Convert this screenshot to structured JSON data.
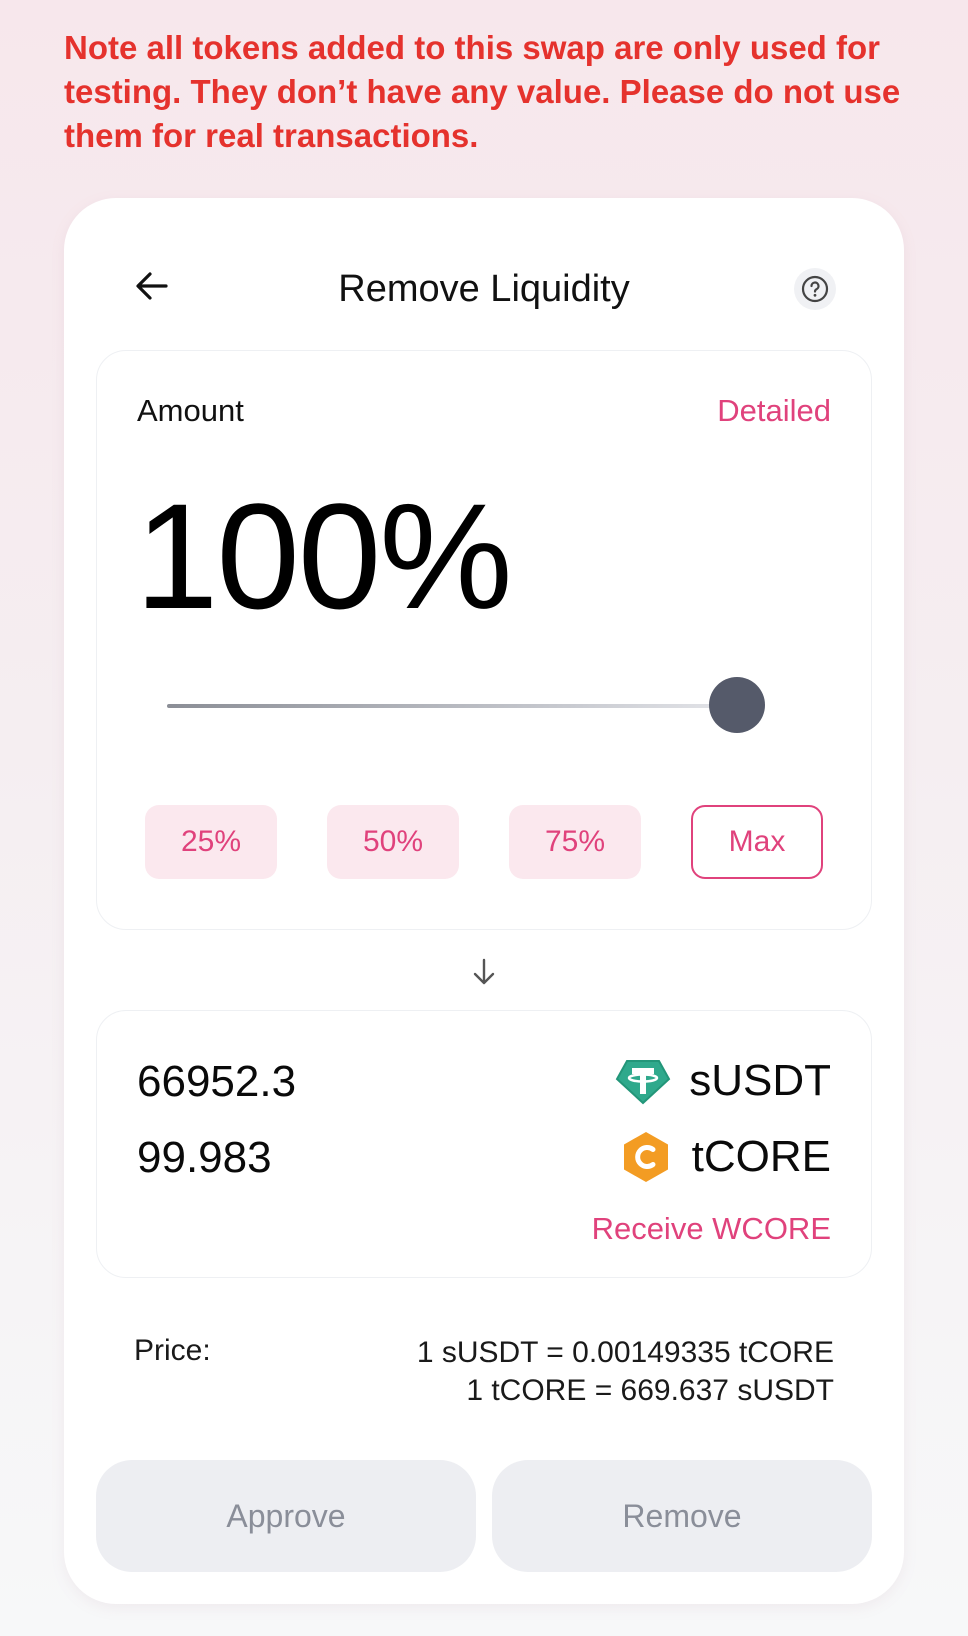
{
  "notice": "Note all tokens added to this swap are only used for testing. They don’t have any value. Please do not use them for real transactions.",
  "header": {
    "title": "Remove Liquidity",
    "back_icon": "arrow-left-icon",
    "help_icon": "question-circle-icon"
  },
  "amount": {
    "label": "Amount",
    "detailed_label": "Detailed",
    "percent_display": "100%",
    "slider_value": 100,
    "presets": [
      "25%",
      "50%",
      "75%",
      "Max"
    ]
  },
  "result": {
    "arrow_icon": "arrow-down-icon",
    "rows": [
      {
        "amount": "66952.3",
        "token": "sUSDT",
        "icon": "tether-icon"
      },
      {
        "amount": "99.983",
        "token": "tCORE",
        "icon": "core-icon"
      }
    ],
    "receive_label": "Receive WCORE"
  },
  "price": {
    "label": "Price:",
    "line1": "1 sUSDT = 0.00149335 tCORE",
    "line2": "1 tCORE = 669.637 sUSDT"
  },
  "actions": {
    "approve_label": "Approve",
    "remove_label": "Remove"
  },
  "colors": {
    "accent": "#e0427c",
    "warning": "#e5322d",
    "button_disabled_bg": "#edeef2",
    "preset_bg": "#fbe8ee",
    "thumb": "#555a6a"
  }
}
